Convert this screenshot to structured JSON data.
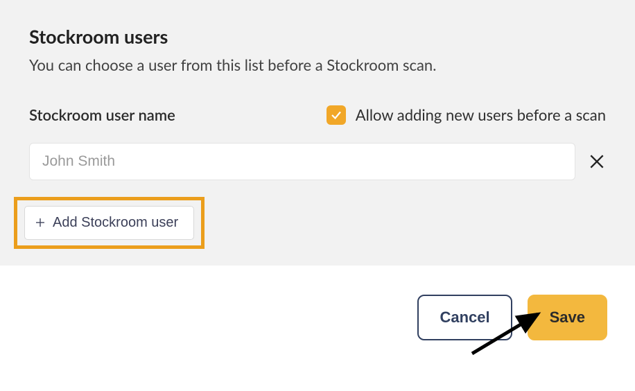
{
  "header": {
    "title": "Stockroom users",
    "subtitle": "You can choose a user from this list before a Stockroom scan."
  },
  "form": {
    "field_label": "Stockroom user name",
    "allow_new_checked": true,
    "allow_new_label": "Allow adding new users before a scan",
    "user_placeholder": "John Smith",
    "user_value": "",
    "add_button_label": "Add Stockroom user"
  },
  "footer": {
    "cancel_label": "Cancel",
    "save_label": "Save"
  }
}
